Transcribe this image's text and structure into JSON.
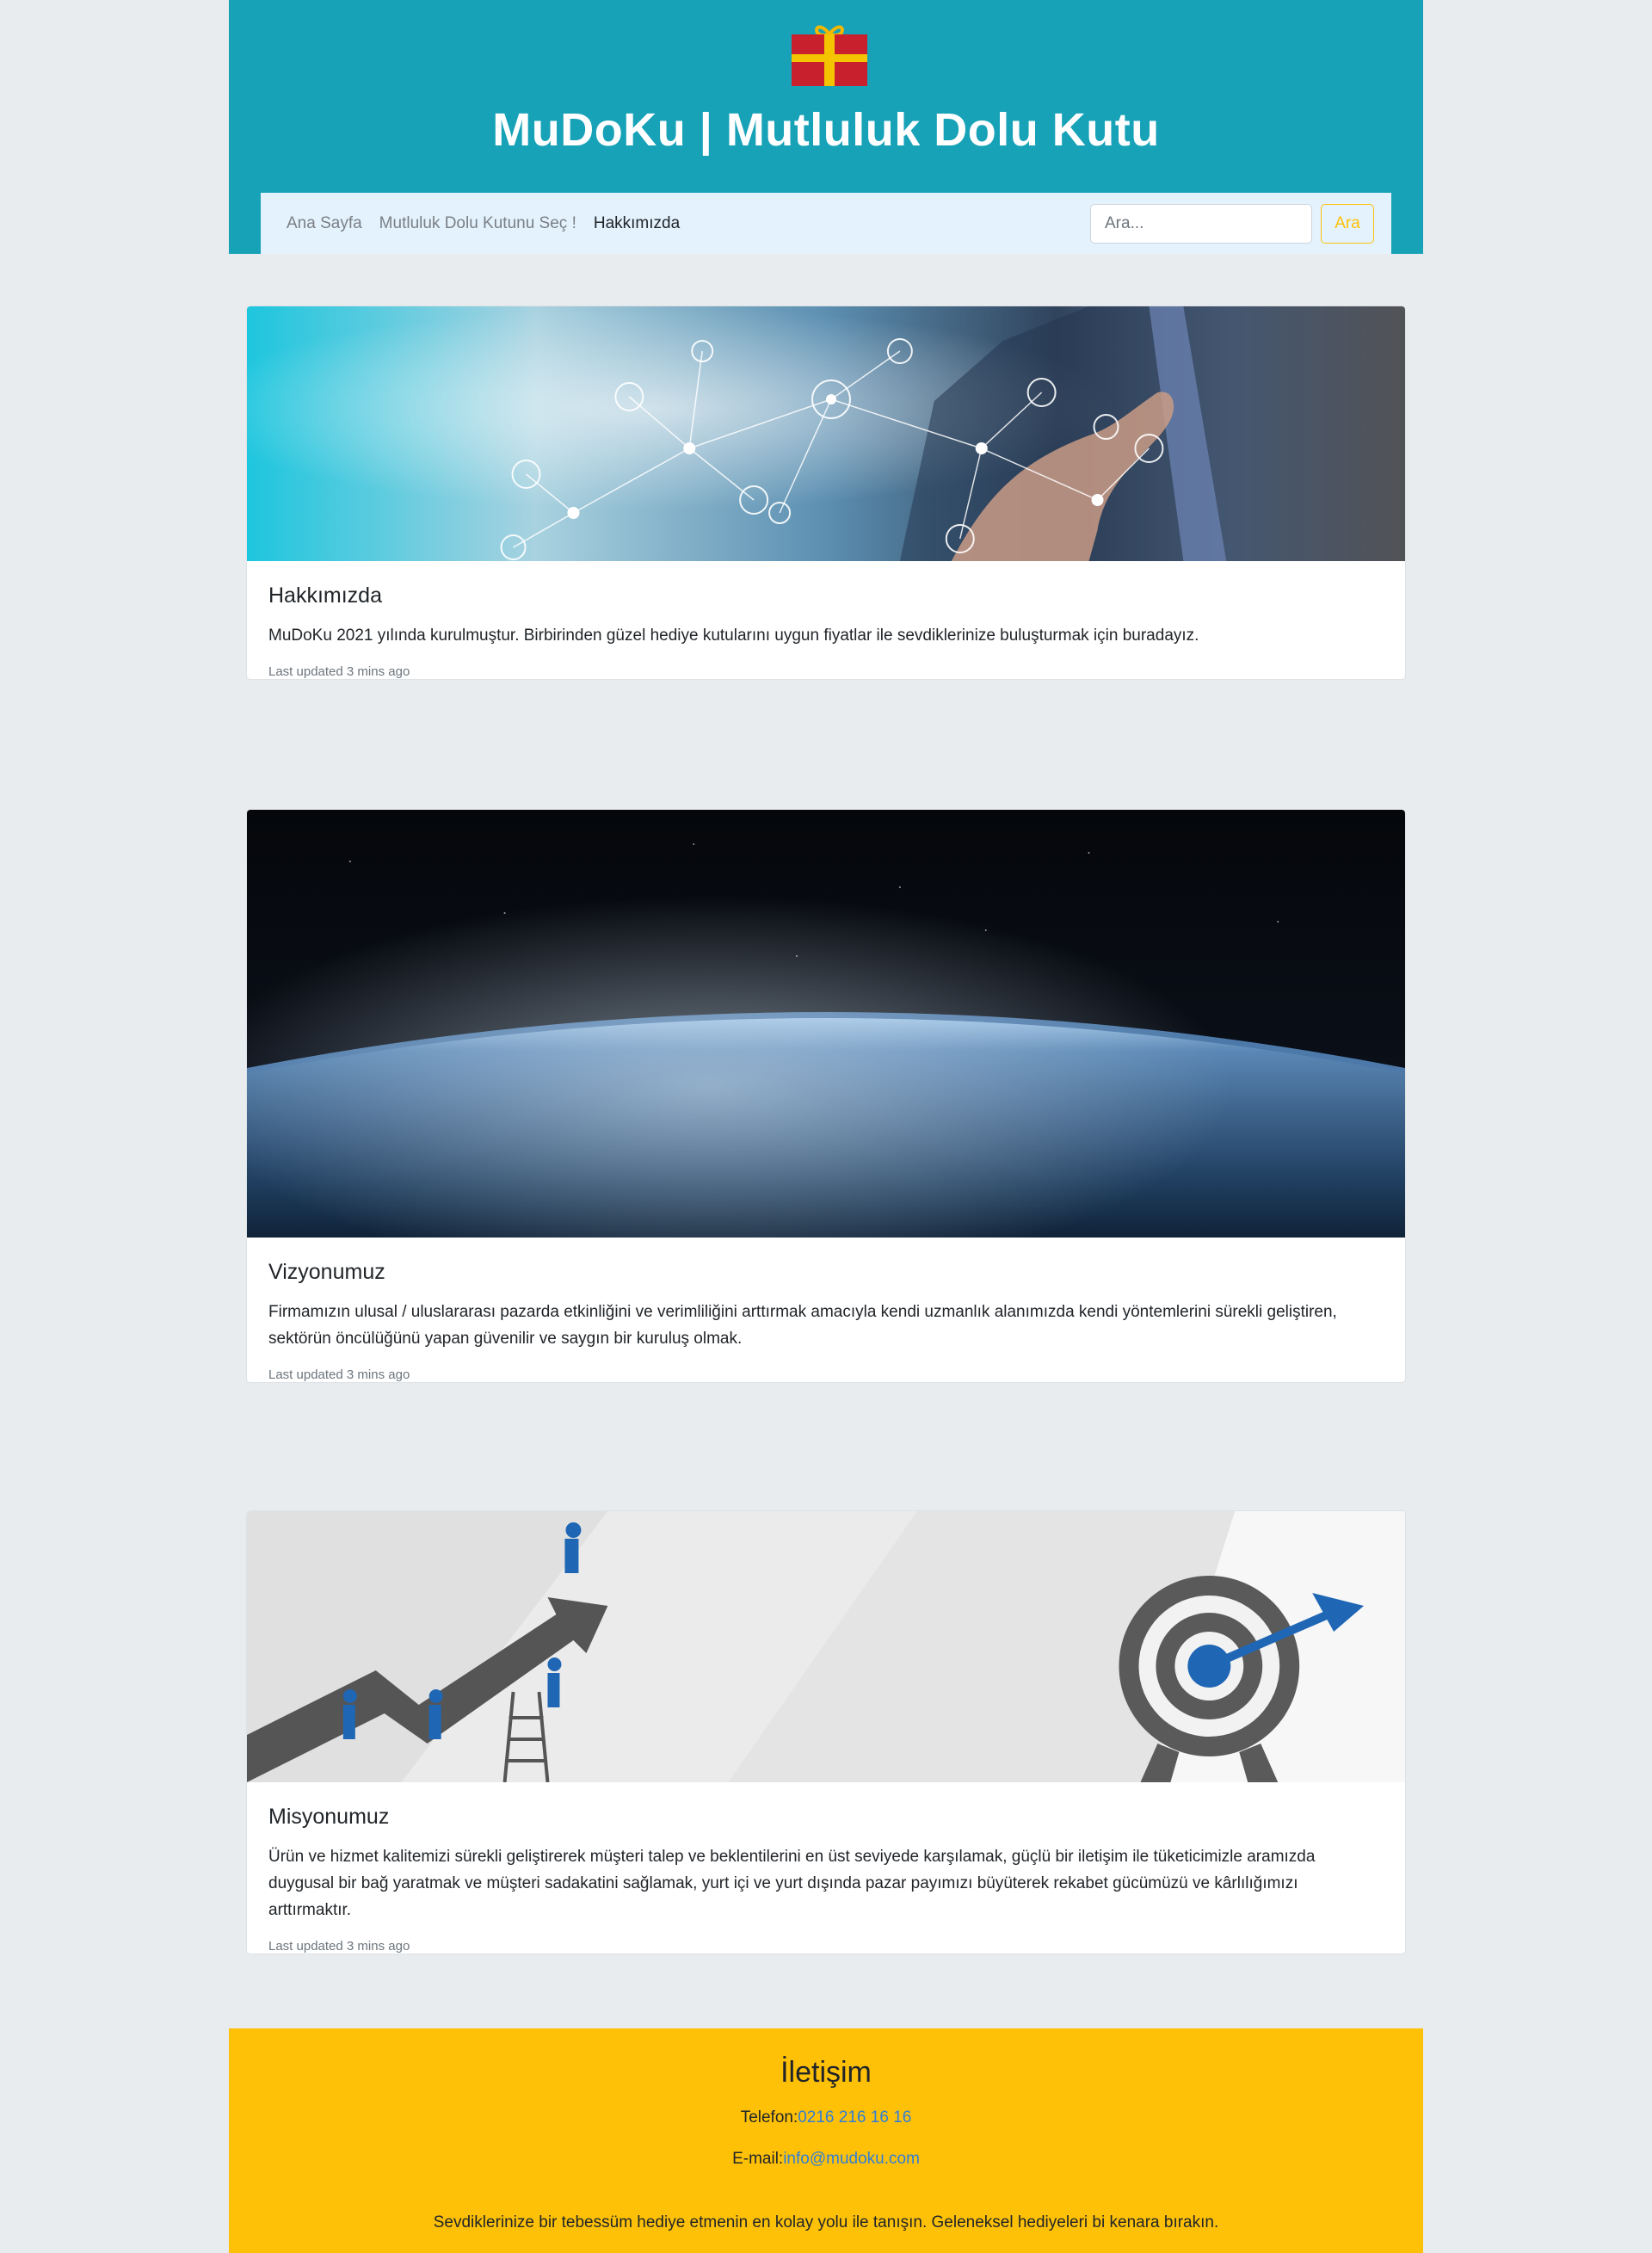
{
  "header": {
    "title": "MuDoKu | Mutluluk Dolu Kutu",
    "logo_icon": "gift-icon",
    "background": "#17a2b8"
  },
  "nav": {
    "items": [
      {
        "label": "Ana Sayfa",
        "active": false
      },
      {
        "label": "Mutluluk Dolu Kutunu Seç !",
        "active": false
      },
      {
        "label": "Hakkımızda",
        "active": true
      }
    ],
    "search_placeholder": "Ara...",
    "search_button": "Ara"
  },
  "cards": [
    {
      "title": "Hakkımızda",
      "text": "MuDoKu 2021 yılında kurulmuştur. Birbirinden güzel hediye kutularını uygun fiyatlar ile sevdiklerinize buluşturmak için buradayız.",
      "updated": "Last updated 3 mins ago",
      "image": "network-technology-image"
    },
    {
      "title": "Vizyonumuz",
      "text": "Firmamızın ulusal / uluslararası pazarda etkinliğini ve verimliliğini arttırmak amacıyla kendi uzmanlık alanımızda kendi yöntemlerini sürekli geliştiren, sektörün öncülüğünü yapan güvenilir ve saygın bir kuruluş olmak.",
      "updated": "Last updated 3 mins ago",
      "image": "earth-from-space-image"
    },
    {
      "title": "Misyonumuz",
      "text": "Ürün ve hizmet kalitemizi sürekli geliştirerek müşteri talep ve beklentilerini en üst seviyede karşılamak, güçlü bir iletişim ile tüketicimizle aramızda duygusal bir bağ yaratmak ve müşteri sadakatini sağlamak, yurt içi ve yurt dışında pazar payımızı büyüterek rekabet gücümüzü ve kârlılığımızı arttırmaktır.",
      "updated": "Last updated 3 mins ago",
      "image": "growth-target-image"
    }
  ],
  "footer": {
    "heading": "İletişim",
    "phone_label": "Telefon:",
    "phone": "0216 216 16 16",
    "email_label": "E-mail:",
    "email": "info@mudoku.com",
    "tagline": "Sevdiklerinize bir tebessüm hediye etmenin en kolay yolu ile tanışın. Geleneksel hediyeleri bi kenara bırakın.",
    "background": "#ffc107",
    "link_color": "#2f7ed8"
  }
}
